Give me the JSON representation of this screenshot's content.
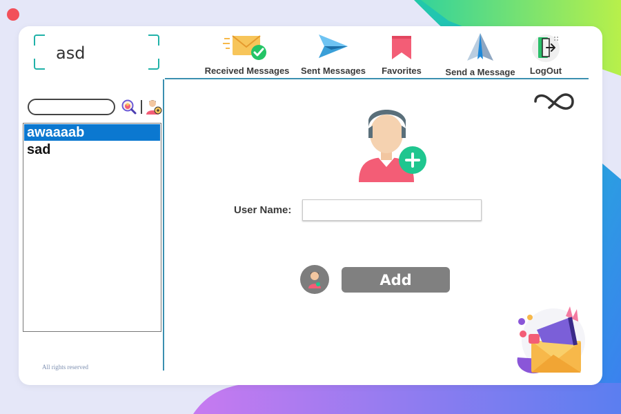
{
  "window": {
    "close_color": "#f2505a"
  },
  "header": {
    "current_user": "asd"
  },
  "nav": {
    "received": "Received Messages",
    "sent": "Sent Messages",
    "favorites": "Favorites",
    "send": "Send a Message",
    "logout": "LogOut"
  },
  "sidebar": {
    "search_value": "",
    "contacts": [
      {
        "name": "awaaaab",
        "selected": true
      },
      {
        "name": "sad",
        "selected": false
      }
    ]
  },
  "main": {
    "user_name_label": "User Name:",
    "user_name_value": "",
    "add_label": "Add"
  },
  "footer": {
    "text": "All rights reserved"
  },
  "icons": {
    "received": "envelope-check-icon",
    "sent": "paper-plane-icon",
    "favorites": "bookmark-icon",
    "send": "send-arrow-icon",
    "logout": "logout-door-icon",
    "search": "search-magnifier-icon",
    "add_contact": "add-contact-icon",
    "infinity": "infinity-icon"
  },
  "colors": {
    "accent": "#3a8fb0",
    "selection": "#0b78d0",
    "bracket": "#20b2a8",
    "button": "#808080"
  }
}
